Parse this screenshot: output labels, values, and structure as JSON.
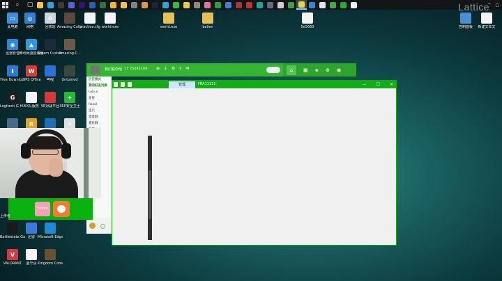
{
  "taskbar": {
    "apps": [
      {
        "name": "file-explorer-icon",
        "color": "#f5c443"
      },
      {
        "name": "edge-icon",
        "color": "#2fa3e0"
      },
      {
        "name": "terminal-icon",
        "color": "#3c3c3c"
      },
      {
        "name": "store-icon",
        "color": "#5a62d6"
      },
      {
        "name": "premiere-icon",
        "color": "#2b1a6b"
      },
      {
        "name": "word-icon",
        "color": "#2b5fb3"
      },
      {
        "name": "excel-icon",
        "color": "#1f7a3f"
      },
      {
        "name": "chrome-icon",
        "color": "#e9b93a"
      },
      {
        "name": "folder-icon",
        "color": "#f0c14b"
      },
      {
        "name": "settings-icon",
        "color": "#7b8588"
      },
      {
        "name": "camera-icon",
        "color": "#df9a3b"
      },
      {
        "name": "steam-icon",
        "color": "#1b2838"
      },
      {
        "name": "qq-icon",
        "color": "#27a7e6"
      },
      {
        "name": "wechat-icon",
        "color": "#3bb74a"
      },
      {
        "name": "smile-icon",
        "color": "#e3d33a"
      },
      {
        "name": "obs-icon",
        "color": "#8a8a8a"
      },
      {
        "name": "bilibili-icon",
        "color": "#e8739a"
      },
      {
        "name": "music-icon",
        "color": "#2e9c3e"
      },
      {
        "name": "chat-icon",
        "color": "#3b7fd6"
      },
      {
        "name": "game-icon",
        "color": "#9a3b3b"
      },
      {
        "name": "red-icon",
        "color": "#c9302c"
      },
      {
        "name": "teal-icon",
        "color": "#1fa39c"
      },
      {
        "name": "phone-icon",
        "color": "#5c6f7a"
      },
      {
        "name": "back-icon",
        "color": "#cfcfcf"
      },
      {
        "name": "green-app-icon",
        "color": "#3aa43e"
      },
      {
        "name": "qq-chat-icon",
        "color": "#e5d64b",
        "active": true
      },
      {
        "name": "blue-app-icon",
        "color": "#2a8ad6"
      },
      {
        "name": "doc-icon",
        "color": "#dfe8ee"
      },
      {
        "name": "game2-icon",
        "color": "#3cae3f"
      },
      {
        "name": "chat2-icon",
        "color": "#2da83a"
      },
      {
        "name": "white-icon",
        "color": "#f0f0f0"
      }
    ],
    "watermark": "Lattice"
  },
  "desktop_icons": [
    {
      "label": "此电脑",
      "color": "#3d8fd8",
      "glyph": "▭"
    },
    {
      "label": "网络",
      "color": "#2f7fcf",
      "glyph": "◎"
    },
    {
      "label": "回收站",
      "color": "#cfd6db",
      "glyph": "♻"
    },
    {
      "label": "Amazing Cultivation...",
      "color": "#5b4a3a",
      "glyph": ""
    },
    {
      "label": "practice.cfg",
      "color": "#f4f4f4",
      "glyph": ""
    },
    {
      "label": "world.exe",
      "color": "#f4f4f4",
      "glyph": ""
    },
    {
      "label": "world.exe",
      "color": "#e6c15a",
      "glyph": ""
    },
    {
      "label": "ballen",
      "color": "#e6c15a",
      "glyph": ""
    },
    {
      "label": "5e5660",
      "color": "#f4f4f4",
      "glyph": ""
    },
    {
      "label": "控制面板",
      "color": "#4a8fd0",
      "glyph": ""
    },
    {
      "label": "新建文本文",
      "color": "#f4f4f4",
      "glyph": ""
    },
    {
      "label": "迅雷影音",
      "color": "#2f86d6",
      "glyph": "◉"
    },
    {
      "label": "腾讯网游加速器",
      "color": "#2d9ae0",
      "glyph": "▲"
    },
    {
      "label": "Steam Customizer",
      "color": "#1c2a3c",
      "glyph": ""
    },
    {
      "label": "Amazing.C...",
      "color": "#6b5a45",
      "glyph": ""
    },
    {
      "label": "Free Downlo...",
      "color": "#2a7bd1",
      "glyph": "⬇"
    },
    {
      "label": "WPS Office",
      "color": "#d93a3a",
      "glyph": "W"
    },
    {
      "label": "哔哩",
      "color": "#2f6fd8",
      "glyph": ""
    },
    {
      "label": "Untumed",
      "color": "#3a4a3a",
      "glyph": ""
    },
    {
      "label": "Logitech G HUB",
      "color": "#1e1e1e",
      "glyph": "G"
    },
    {
      "label": "XX队服务",
      "color": "#f4f4f4",
      "glyph": ""
    },
    {
      "label": "5E对战平台",
      "color": "#d43a3a",
      "glyph": ""
    },
    {
      "label": "360安全卫士",
      "color": "#2fb43a",
      "glyph": "+"
    },
    {
      "label": "GO",
      "color": "#4a6a8a",
      "glyph": ""
    },
    {
      "label": "",
      "color": "#e8a020",
      "glyph": "R"
    },
    {
      "label": "",
      "color": "#1f6fb5",
      "glyph": ""
    },
    {
      "label": "",
      "color": "#e0e0e0",
      "glyph": "✕"
    },
    {
      "label": "Battlestate Games L...",
      "color": "#1a1a1a",
      "glyph": ""
    },
    {
      "label": "迅雷",
      "color": "#3a7ad8",
      "glyph": ""
    },
    {
      "label": "Microsoft Edge",
      "color": "#1d8bd6",
      "glyph": ""
    },
    {
      "label": "VALORANT",
      "color": "#d23a43",
      "glyph": "V"
    },
    {
      "label": "金华弘",
      "color": "#f4f4f4",
      "glyph": ""
    },
    {
      "label": "Kingdom Come Del...",
      "color": "#6a5030",
      "glyph": ""
    }
  ],
  "qq_main": {
    "name": "我们看你他",
    "account": "17 75241104",
    "toolbar": "⊕ ↓ ⚙ ▾ ✉",
    "contacts": [
      "历史模式",
      "我的好友列表",
      "Lolo.e",
      "星星",
      "Rosal",
      "宝贝",
      "漫友群",
      "家长群",
      "潘越"
    ]
  },
  "chat_window": {
    "tab_label": "管理",
    "window_title": "FRA11111",
    "controls": {
      "minimize": "—",
      "maximize": "☐",
      "close": "✕"
    }
  },
  "bottom_overlay": {
    "uploader": "上传者",
    "app1_label": "bilibili"
  }
}
